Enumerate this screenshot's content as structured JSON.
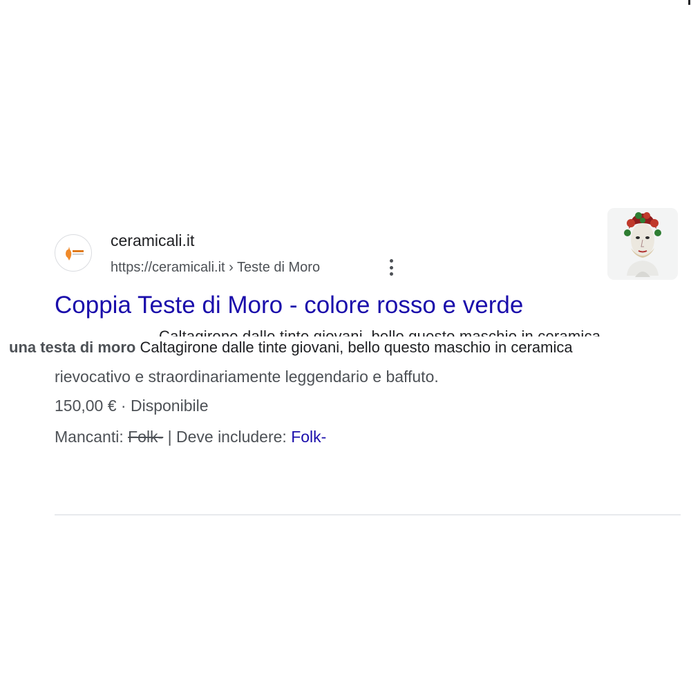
{
  "result": {
    "site_name": "ceramicali.it",
    "url": "https://ceramicali.it",
    "breadcrumb_separator": " › ",
    "breadcrumb_path": "Teste di Moro",
    "more_options_icon": "three-dots-vertical-icon",
    "title": "Coppia Teste di Moro - colore rosso e verde",
    "snippet": {
      "bold_prefix": "una testa di moro",
      "line1_rest": " Caltagirone dalle tinte giovani, bello questo maschio in ceramica",
      "line2": "rievocativo e straordinariamente leggendario e baffuto."
    },
    "price": "150,00 €",
    "price_separator": " · ",
    "availability": "Disponibile",
    "missing_label": "Mancanti: ",
    "missing_term": "Folk-",
    "must_include_label": " | Deve includere: ",
    "must_include_term": "Folk-"
  },
  "colors": {
    "title_link": "#1a0dab",
    "snippet_text": "#4d5156",
    "divider": "#e8eaed"
  }
}
